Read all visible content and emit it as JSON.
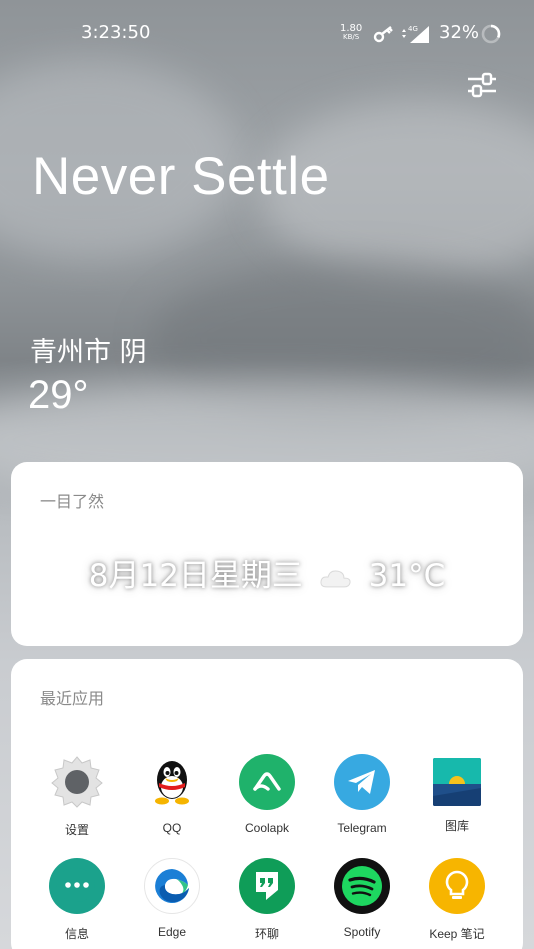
{
  "status_bar": {
    "time": "3:23:50",
    "net_speed": "1.80",
    "net_unit": "KB/S",
    "network_type": "4G",
    "battery": "32%",
    "battery_level": 0.32
  },
  "wallpaper": {
    "headline": "Never Settle",
    "city": "青州市  阴",
    "temperature": "29°"
  },
  "glance_card": {
    "title": "一目了然",
    "date": "8月12日星期三",
    "temp": "31°C"
  },
  "recent_apps": {
    "title": "最近应用",
    "apps": [
      {
        "label": "设置",
        "icon": "settings-gear-icon"
      },
      {
        "label": "QQ",
        "icon": "qq-penguin-icon"
      },
      {
        "label": "Coolapk",
        "icon": "coolapk-icon"
      },
      {
        "label": "Telegram",
        "icon": "telegram-icon"
      },
      {
        "label": "图库",
        "icon": "gallery-icon"
      },
      {
        "label": "信息",
        "icon": "messages-icon"
      },
      {
        "label": "Edge",
        "icon": "edge-icon"
      },
      {
        "label": "环聊",
        "icon": "hangouts-icon"
      },
      {
        "label": "Spotify",
        "icon": "spotify-icon"
      },
      {
        "label": "Keep 笔记",
        "icon": "keep-icon"
      }
    ]
  },
  "colors": {
    "coolapk": "#1fb26b",
    "telegram": "#37a9e1",
    "messages": "#1ba28c",
    "hangouts": "#0f9d58",
    "spotify": "#1ed760",
    "keep": "#f7b500"
  }
}
